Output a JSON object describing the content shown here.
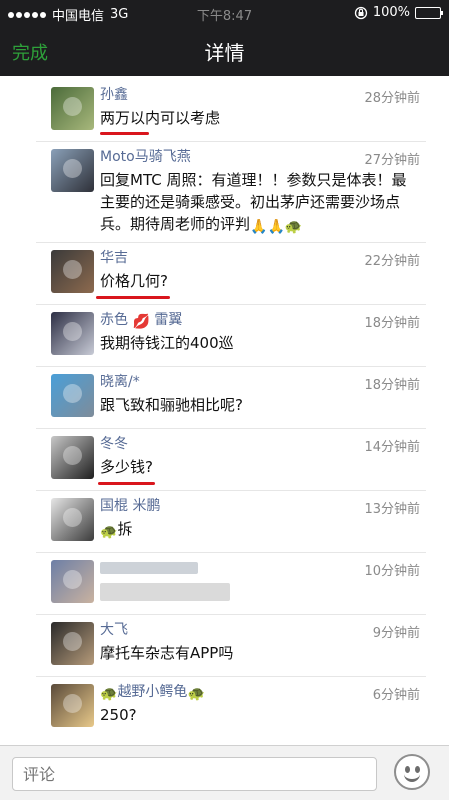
{
  "status_bar": {
    "carrier": "中国电信",
    "network": "3G",
    "time": "下午8:47",
    "battery": "100%"
  },
  "nav": {
    "done_label": "完成",
    "title": "详情"
  },
  "comments": [
    {
      "name": "孙鑫",
      "time": "28分钟前",
      "text": "两万以内可以考虑"
    },
    {
      "name": "Moto马骑飞燕",
      "time": "27分钟前",
      "text": "回复MTC 周照：有道理！！参数只是体表！最主要的还是骑乘感受。初出茅庐还需要沙场点兵。期待周老师的评判"
    },
    {
      "name": "华吉",
      "time": "22分钟前",
      "text": "价格几何?"
    },
    {
      "name": "赤色",
      "name_suffix": "雷翼",
      "time": "18分钟前",
      "text": "我期待钱江的400巡"
    },
    {
      "name": "晓离/*",
      "time": "18分钟前",
      "text": "跟飞致和骊驰相比呢?"
    },
    {
      "name": "冬冬",
      "time": "14分钟前",
      "text": "多少钱?"
    },
    {
      "name": "国棍 米鹏",
      "time": "13分钟前",
      "text": "拆"
    },
    {
      "name": "",
      "time": "10分钟前",
      "text": ""
    },
    {
      "name": "大飞",
      "time": "9分钟前",
      "text": "摩托车杂志有APP吗"
    },
    {
      "name": "越野小鳄龟",
      "time": "6分钟前",
      "text": "250?"
    }
  ],
  "input": {
    "placeholder": "评论"
  },
  "icons": {
    "signal": "signal-dots-icon",
    "lock": "orientation-lock-icon",
    "battery": "battery-icon",
    "emoji": "emoji-face-icon",
    "lips": "lips-icon",
    "pray": "praying-hands-icon",
    "turtle": "turtle-icon"
  },
  "colors": {
    "nav_bg": "#1d1d1f",
    "done_green": "#2ea13a",
    "name_blue": "#576b95",
    "highlight_red": "#d9161d"
  }
}
